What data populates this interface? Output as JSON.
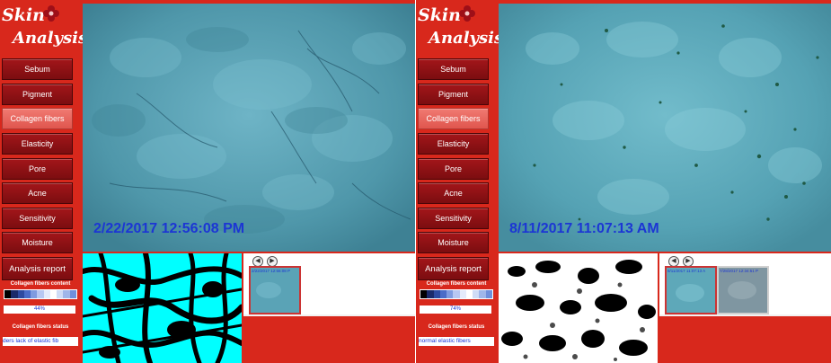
{
  "left_panel": {
    "logo": {
      "word1": "Skin",
      "word2": "Analysis"
    },
    "menu": [
      "Sebum",
      "Pigment",
      "Collagen fibers",
      "Elasticity",
      "Pore",
      "Acne",
      "Sensitivity",
      "Moisture"
    ],
    "active_item": "Collagen fibers",
    "analysis_report": "Analysis report",
    "content_label": "Collagen fibers content",
    "content_percent": "44%",
    "content_level": 0.44,
    "status_label": "Collagen fibers status",
    "status_value": "ders lack of elastic fib",
    "timestamp": "2/22/2017 12:56:08 PM",
    "thumbnails": [
      {
        "caption": "2/22/2017 12:56:08 P"
      }
    ]
  },
  "right_panel": {
    "logo": {
      "word1": "Skin",
      "word2": "Analysis"
    },
    "menu": [
      "Sebum",
      "Pigment",
      "Collagen fibers",
      "Elasticity",
      "Pore",
      "Acne",
      "Sensitivity",
      "Moisture"
    ],
    "active_item": "Collagen fibers",
    "analysis_report": "Analysis report",
    "content_label": "Collagen fibers content",
    "content_percent": "74%",
    "content_level": 0.74,
    "status_label": "Collagen fibers status",
    "status_value": "normal elastic fibers",
    "timestamp": "8/11/2017 11:07:13 AM",
    "thumbnails": [
      {
        "caption": "8/11/2017 11:07:13 A"
      },
      {
        "caption": "7/28/2017 12:34:51 P"
      }
    ]
  },
  "icons": {
    "prev": "chevron-left-icon",
    "next": "chevron-right-icon",
    "logo_flower": "flower-icon"
  },
  "colors": {
    "panel_red": "#d8281c",
    "button_dark_red": "#8b1014",
    "button_active": "#e8635b",
    "timestamp_blue": "#1c36d4",
    "binary_cyan": "#00ffff"
  }
}
